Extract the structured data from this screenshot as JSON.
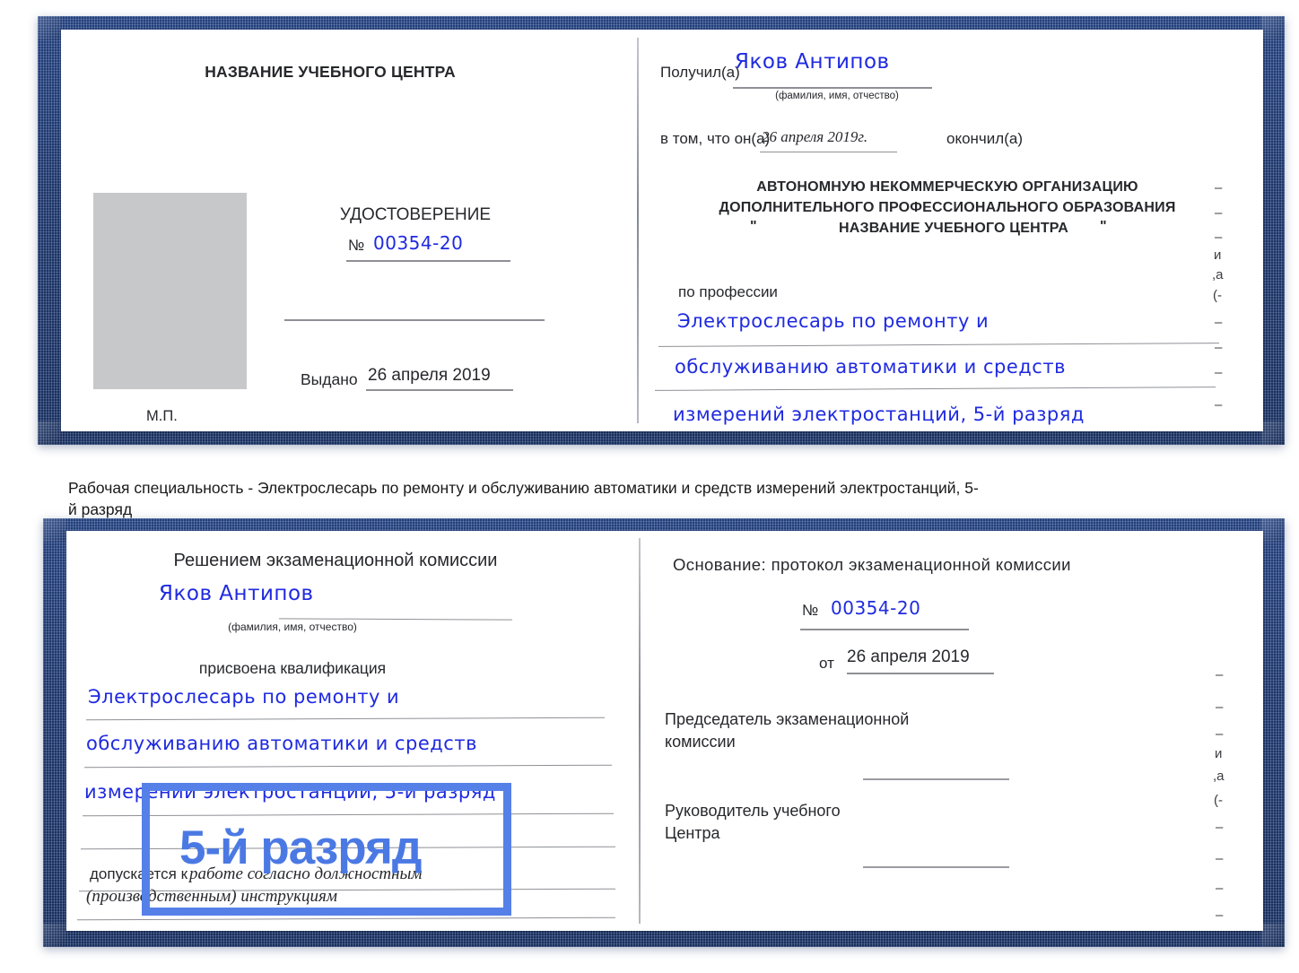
{
  "document": {
    "type": "certificate-booklet",
    "title_caption": "Рабочая специальность - Электрослесарь по ремонту и обслуживанию автоматики и средств измерений электростанций, 5-й разряд"
  },
  "colors": {
    "cover_blue": "#25427f",
    "handwriting_blue": "#1f2ae0",
    "highlight_blue": "#5580e8",
    "highlight_text_blue": "#4b79e4",
    "photo_placeholder": "#c7c8ca"
  },
  "booklet_top": {
    "left_page": {
      "header": "НАЗВАНИЕ УЧЕБНОГО ЦЕНТРА",
      "doc_title": "УДОСТОВЕРЕНИЕ",
      "number_label": "№",
      "number_value": "00354-20",
      "issued_label": "Выдано",
      "issued_value": "26 апреля 2019",
      "seal_label": "М.П.",
      "photo_placeholder_alt": "photo"
    },
    "right_page": {
      "received_label": "Получил(а)",
      "received_value": "Яков Антипов",
      "name_hint": "(фамилия, имя, отчество)",
      "in_that_label": "в том, что он(а)",
      "completion_date": "26 апреля 2019г.",
      "finished_label": "окончил(а)",
      "org_line1": "АВТОНОМНУЮ НЕКОММЕРЧЕСКУЮ ОРГАНИЗАЦИЮ",
      "org_line2": "ДОПОЛНИТЕЛЬНОГО ПРОФЕССИОНАЛЬНОГО ОБРАЗОВАНИЯ",
      "org_quote_open": "\"",
      "org_line3": "НАЗВАНИЕ УЧЕБНОГО ЦЕНТРА",
      "org_quote_close": "\"",
      "profession_label": "по профессии",
      "profession_line1": "Электрослесарь по ремонту и",
      "profession_line2": "обслуживанию автоматики и средств",
      "profession_line3": "измерений электростанций, 5-й разряд",
      "edge_fragments": [
        "и",
        ",а",
        "(-"
      ]
    }
  },
  "booklet_bottom": {
    "left_page": {
      "header": "Решением экзаменационной комиссии",
      "name_value": "Яков Антипов",
      "name_hint": "(фамилия, имя, отчество)",
      "qualification_label": "присвоена квалификация",
      "qualification_line1": "Электрослесарь по ремонту и",
      "qualification_line2": "обслуживанию автоматики и средств",
      "qualification_line3": "измерений электростанций, 5-й разряд",
      "admitted_label": "допускается к",
      "admitted_value_line1": "работе согласно должностным",
      "admitted_value_line2": "(производственным) инструкциям"
    },
    "right_page": {
      "basis_label": "Основание: протокол экзаменационной комиссии",
      "number_label": "№",
      "number_value": "00354-20",
      "date_label": "от",
      "date_value": "26 апреля 2019",
      "chairman_line1": "Председатель экзаменационной",
      "chairman_line2": "комиссии",
      "director_line1": "Руководитель учебного",
      "director_line2": "Центра",
      "edge_fragments": [
        "и",
        ",а",
        "(-"
      ]
    }
  },
  "highlight": {
    "label": "5-й разряд"
  }
}
